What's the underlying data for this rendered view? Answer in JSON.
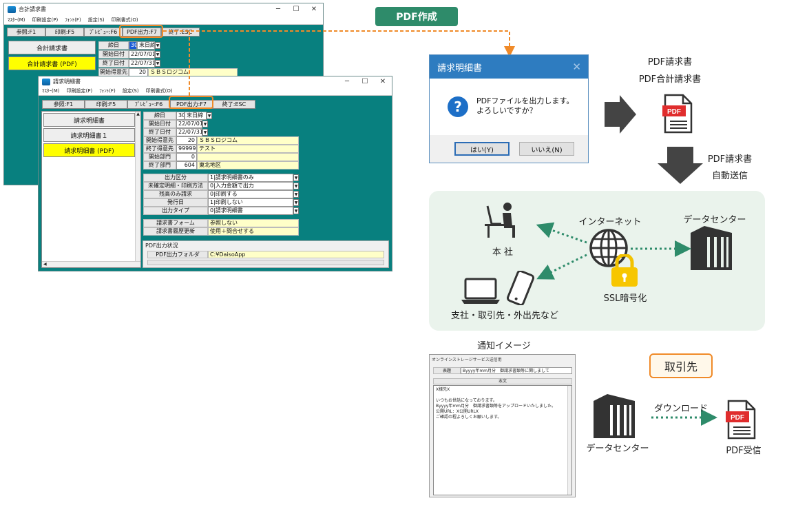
{
  "win1": {
    "title": "合計請求書",
    "menu": [
      "ﾏｽﾀｰ(M)",
      "印刷設定(P)",
      "ﾌｫﾝﾄ(F)",
      "設定(S)",
      "印刷書式(O)"
    ],
    "fkeys": [
      "参照:F1",
      "印刷:F5",
      "ﾌﾟﾚﾋﾞｭｰ:F6",
      "PDF出力:F7",
      "終了:ESC"
    ],
    "nav": [
      "合計請求書",
      "合計請求書 (PDF)"
    ],
    "fields": {
      "shime_label": "締日",
      "shime_num": "30",
      "shime_val": "末日締",
      "start_label": "開始日付",
      "start_val": "22/07/01",
      "end_label": "終了日付",
      "end_val": "22/07/31",
      "cust_label": "開始得意先",
      "cust_num": "20",
      "cust_val": "ＳＢＳロジコム"
    }
  },
  "win2": {
    "title": "請求明細書",
    "menu": [
      "ﾏｽﾀｰ(M)",
      "印刷設定(P)",
      "ﾌｫﾝﾄ(F)",
      "設定(S)",
      "印刷書式(O)"
    ],
    "fkeys": [
      "参照:F1",
      "印刷:F5",
      "ﾌﾟﾚﾋﾞｭｰ:F6",
      "PDF出力:F7",
      "終了:ESC"
    ],
    "nav": [
      "請求明細書",
      "請求明細書１",
      "請求明細書 (PDF)"
    ],
    "fields": {
      "shime_label": "締日",
      "shime_num": "30",
      "shime_val": "末日締",
      "start_label": "開始日付",
      "start_val": "22/07/01",
      "end_label": "終了日付",
      "end_val": "22/07/31",
      "cust_s_label": "開始得意先",
      "cust_s_num": "20",
      "cust_s_val": "ＳＢＳロジコム",
      "cust_e_label": "終了得意先",
      "cust_e_num": "999999",
      "cust_e_val": "テスト",
      "dept_s_label": "開始部門",
      "dept_s_num": "0",
      "dept_s_val": "",
      "dept_e_label": "終了部門",
      "dept_e_num": "604",
      "dept_e_val": "東北地区"
    },
    "options": [
      {
        "label": "出力区分",
        "value": "1|請求明細書のみ"
      },
      {
        "label": "未確定明細・印刷方法",
        "value": "0|入力金額で出力"
      },
      {
        "label": "残高のみ請求",
        "value": "0|印刷する"
      },
      {
        "label": "発行日",
        "value": "1|印刷しない"
      },
      {
        "label": "出力タイプ",
        "value": "0|請求明細書"
      }
    ],
    "form": [
      {
        "label": "請求書フォーム",
        "value": "参照しない"
      },
      {
        "label": "請求書履歴更新",
        "value": "使用＋問合せする"
      }
    ],
    "pdf_status_title": "PDF出力状況",
    "pdf_folder_label": "PDF出力フォルダ",
    "pdf_folder_val": "C:¥DaisoApp"
  },
  "dialog": {
    "title": "請求明細書",
    "close": "✕",
    "icon": "?",
    "line1": "PDFファイルを出力します。",
    "line2": "よろしいですか？",
    "yes": "はい(Y)",
    "no": "いいえ(N)"
  },
  "diagram": {
    "pdf_create": "PDF作成",
    "pdf_out_1": "PDF請求書",
    "pdf_out_2": "PDF合計請求書",
    "pdf_badge": "PDF",
    "auto_send_1": "PDF請求書",
    "auto_send_2": "自動送信",
    "internet": "インターネット",
    "datacenter": "データセンター",
    "honsha": "本 社",
    "ssl": "SSL暗号化",
    "branches": "支社・取引先・外出先など",
    "notify": "通知イメージ",
    "torihiki": "取引先",
    "download": "ダウンロード",
    "datacenter2": "データセンター",
    "pdf_receive": "PDF受信"
  },
  "notification": {
    "title": "オンラインストレージサービス送信用",
    "subject_label": "表題",
    "subject_val": "Byyyy年mm月分　御請求書類等に関しまして",
    "body_label": "本文",
    "body": [
      "X様先X",
      "",
      "いつもお世話になっております。",
      "Byyyy年mm月分　御請求書類等をアップロードいたしました。",
      "公開URL：X公開URLX",
      "ご確認の程よろしくお願いします。"
    ]
  },
  "colors": {
    "teal": "#08807f",
    "accent_orange": "#f08a28",
    "green": "#2e8b6a",
    "dialog_blue": "#2e7cc0",
    "pdf_red": "#e02d2d"
  }
}
